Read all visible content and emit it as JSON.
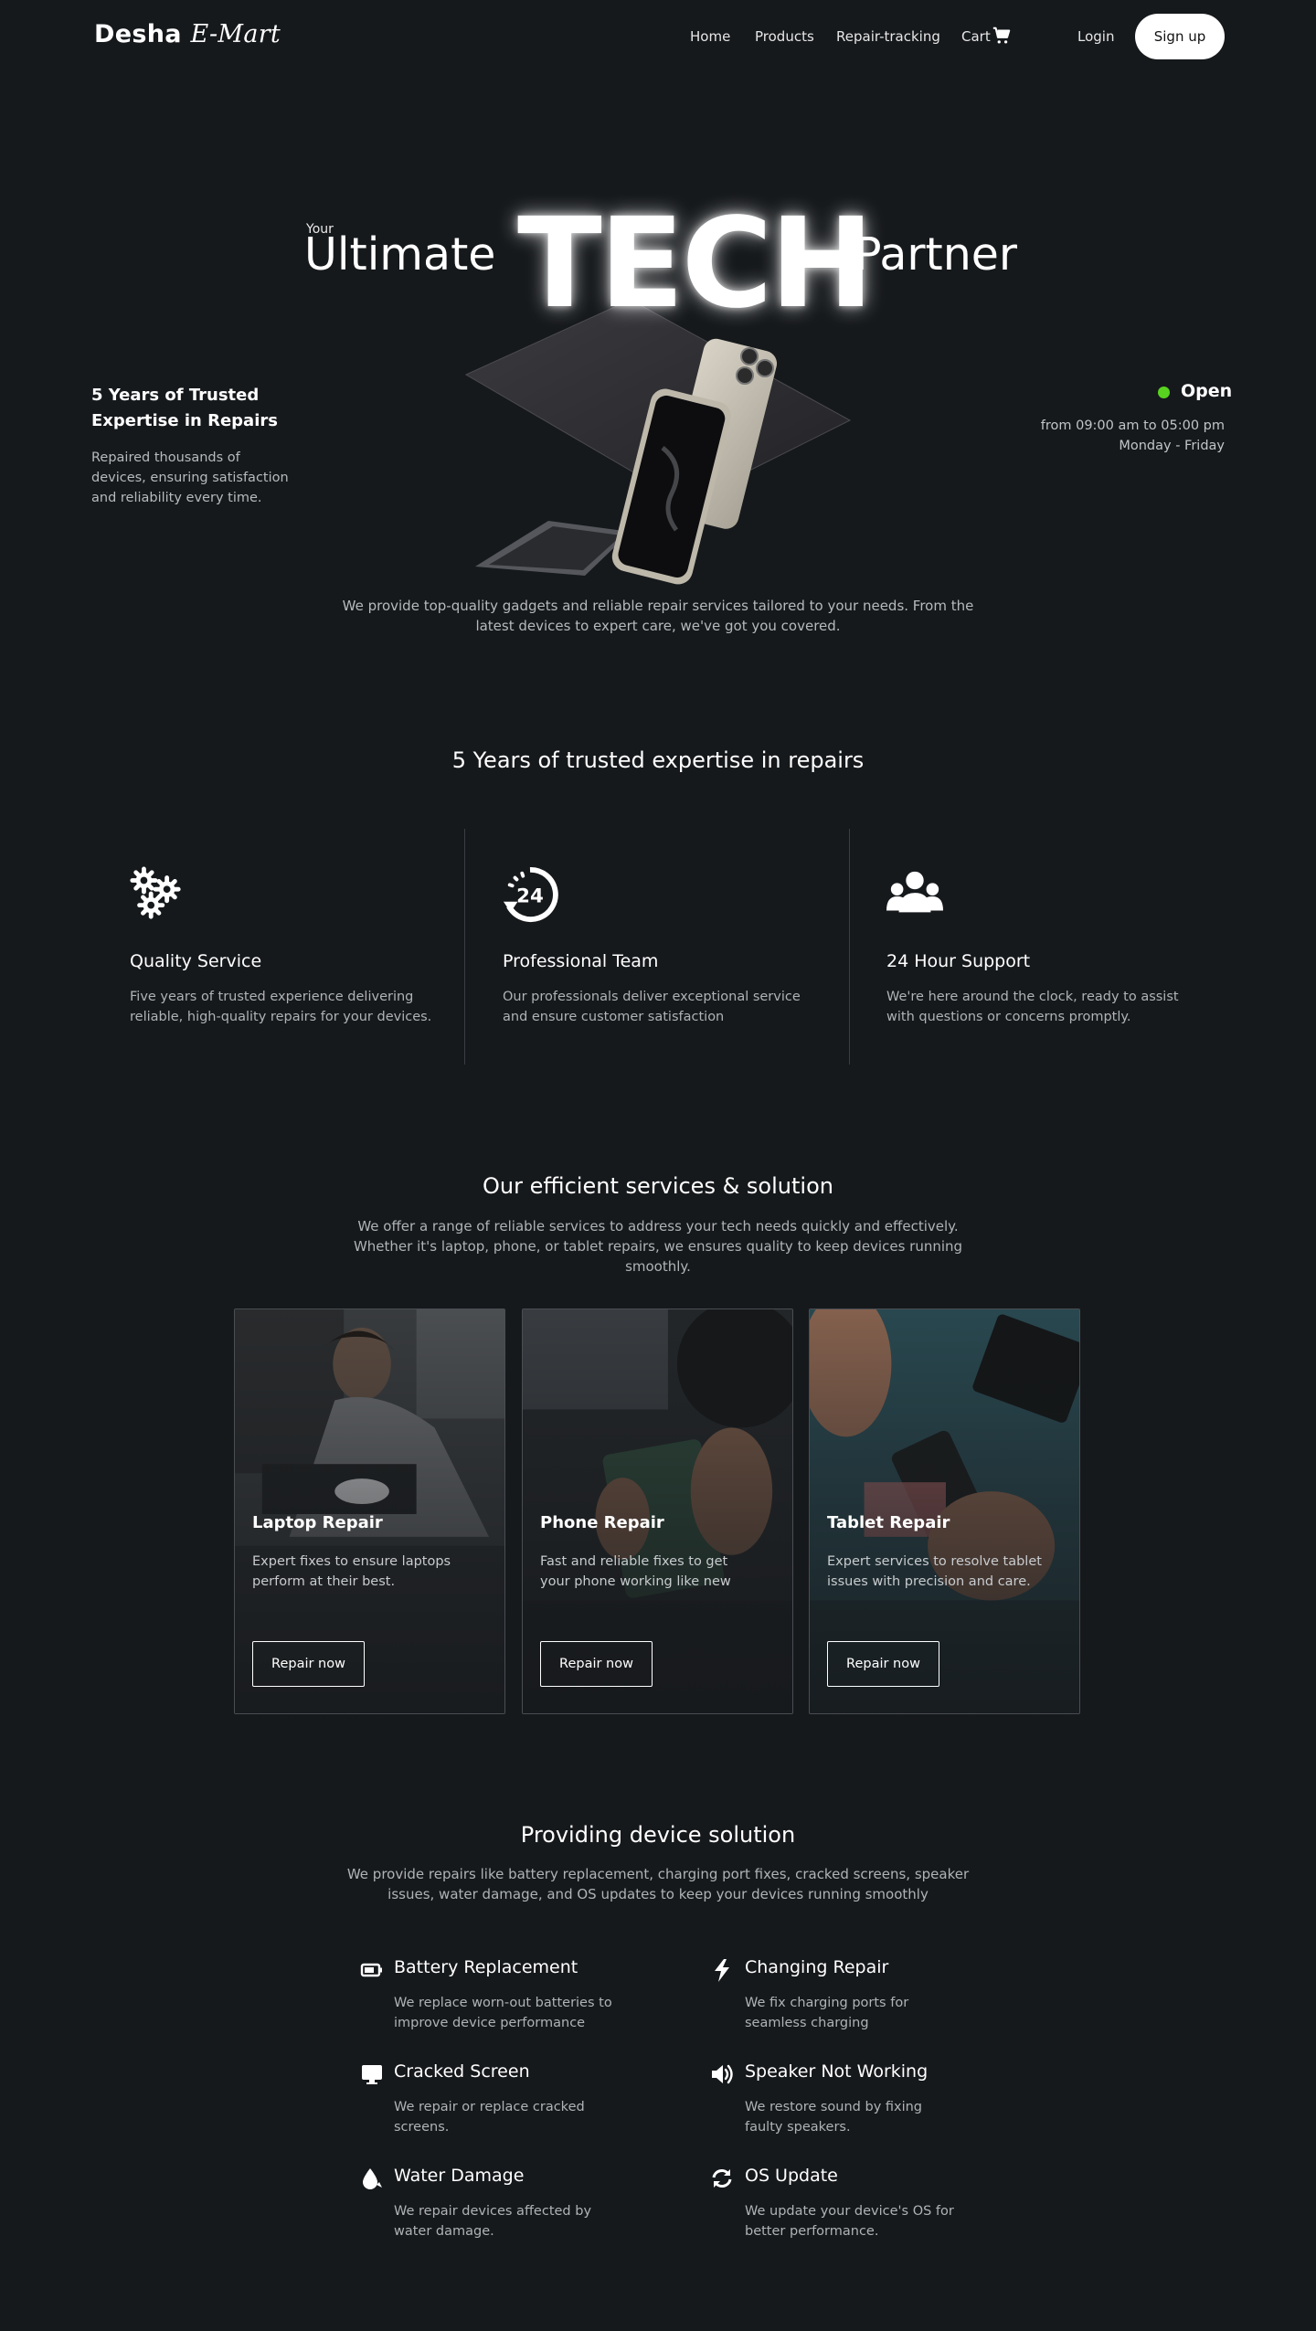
{
  "nav": {
    "logo_main": "Desha",
    "logo_script": "E-Mart",
    "links": [
      "Home",
      "Products",
      "Repair-tracking"
    ],
    "cart_label": "Cart",
    "login_label": "Login",
    "signup_label": "Sign up"
  },
  "hero": {
    "your": "Your",
    "ultimate": "Ultimate",
    "tech": "TECH",
    "partner": "Partner",
    "left_heading": "5 Years of Trusted Expertise in Repairs",
    "left_desc": "Repaired thousands of devices, ensuring satisfaction and reliability every time.",
    "status": "Open",
    "hours_line1": "from 09:00 am to 05:00 pm",
    "hours_line2": "Monday - Friday",
    "desc": "We provide top-quality gadgets and reliable repair services tailored to your needs. From the latest devices to expert care, we've got you covered.",
    "status_color": "#58d31f"
  },
  "expertise": {
    "title": "5 Years of trusted expertise in repairs",
    "features": [
      {
        "icon": "gears-icon",
        "title": "Quality Service",
        "desc": "Five years of trusted experience delivering reliable, high-quality repairs for your devices."
      },
      {
        "icon": "clock-24-icon",
        "title": "Professional Team",
        "desc": "Our professionals deliver exceptional service and ensure customer satisfaction"
      },
      {
        "icon": "users-icon",
        "title": "24 Hour Support",
        "desc": "We're here around the clock, ready to assist with questions or concerns promptly."
      }
    ]
  },
  "services": {
    "title": "Our efficient services & solution",
    "subtitle": "We offer a range of reliable services to address your tech needs quickly and effectively. Whether it's laptop, phone, or tablet repairs, we ensures quality to keep devices running smoothly.",
    "cards": [
      {
        "title": "Laptop Repair",
        "desc": "Expert fixes to ensure laptops perform at their best.",
        "button": "Repair now"
      },
      {
        "title": "Phone Repair",
        "desc": "Fast and reliable fixes to get your phone working like new",
        "button": "Repair now"
      },
      {
        "title": "Tablet Repair",
        "desc": "Expert services to resolve tablet issues with precision and care.",
        "button": "Repair now"
      }
    ]
  },
  "solutions": {
    "title": "Providing device solution",
    "subtitle": "We provide repairs like battery replacement, charging port fixes, cracked screens, speaker issues, water damage, and OS updates  to keep your devices running smoothly",
    "items": [
      {
        "icon": "battery-icon",
        "title": "Battery Replacement",
        "desc": "We replace worn-out batteries to improve device performance"
      },
      {
        "icon": "bolt-icon",
        "title": "Changing Repair",
        "desc": "We fix charging ports for seamless charging"
      },
      {
        "icon": "monitor-icon",
        "title": "Cracked Screen",
        "desc": "We repair or replace cracked screens."
      },
      {
        "icon": "speaker-icon",
        "title": "Speaker Not Working",
        "desc": "We restore sound by fixing faulty speakers."
      },
      {
        "icon": "water-drop-icon",
        "title": "Water Damage",
        "desc": "We repair devices affected by water damage."
      },
      {
        "icon": "sync-icon",
        "title": "OS Update",
        "desc": "We update your device's OS for better performance."
      }
    ]
  }
}
